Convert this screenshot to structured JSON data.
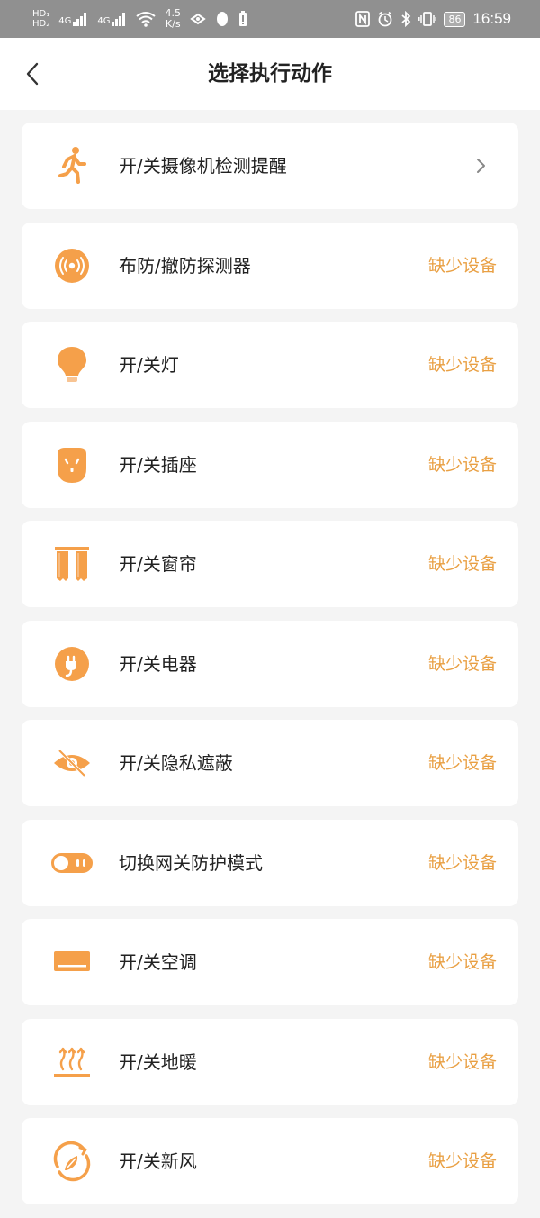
{
  "status_bar": {
    "sim1": "HD₁",
    "sim2": "HD₂",
    "net1": "4G",
    "net2": "4G",
    "speed_value": "4.5",
    "speed_unit": "K/s",
    "battery": "86",
    "time": "16:59"
  },
  "header": {
    "title": "选择执行动作"
  },
  "colors": {
    "accent": "#F5A04A",
    "status_text": "#E9A044"
  },
  "items": [
    {
      "label": "开/关摄像机检测提醒",
      "status": "",
      "icon": "running-person-icon",
      "has_chevron": true
    },
    {
      "label": "布防/撤防探测器",
      "status": "缺少设备",
      "icon": "detector-icon"
    },
    {
      "label": "开/关灯",
      "status": "缺少设备",
      "icon": "bulb-icon"
    },
    {
      "label": "开/关插座",
      "status": "缺少设备",
      "icon": "socket-icon"
    },
    {
      "label": "开/关窗帘",
      "status": "缺少设备",
      "icon": "curtain-icon"
    },
    {
      "label": "开/关电器",
      "status": "缺少设备",
      "icon": "plug-icon"
    },
    {
      "label": "开/关隐私遮蔽",
      "status": "缺少设备",
      "icon": "eye-off-icon"
    },
    {
      "label": "切换网关防护模式",
      "status": "缺少设备",
      "icon": "toggle-icon"
    },
    {
      "label": "开/关空调",
      "status": "缺少设备",
      "icon": "air-conditioner-icon"
    },
    {
      "label": "开/关地暖",
      "status": "缺少设备",
      "icon": "floor-heating-icon"
    },
    {
      "label": "开/关新风",
      "status": "缺少设备",
      "icon": "fresh-air-icon"
    }
  ]
}
